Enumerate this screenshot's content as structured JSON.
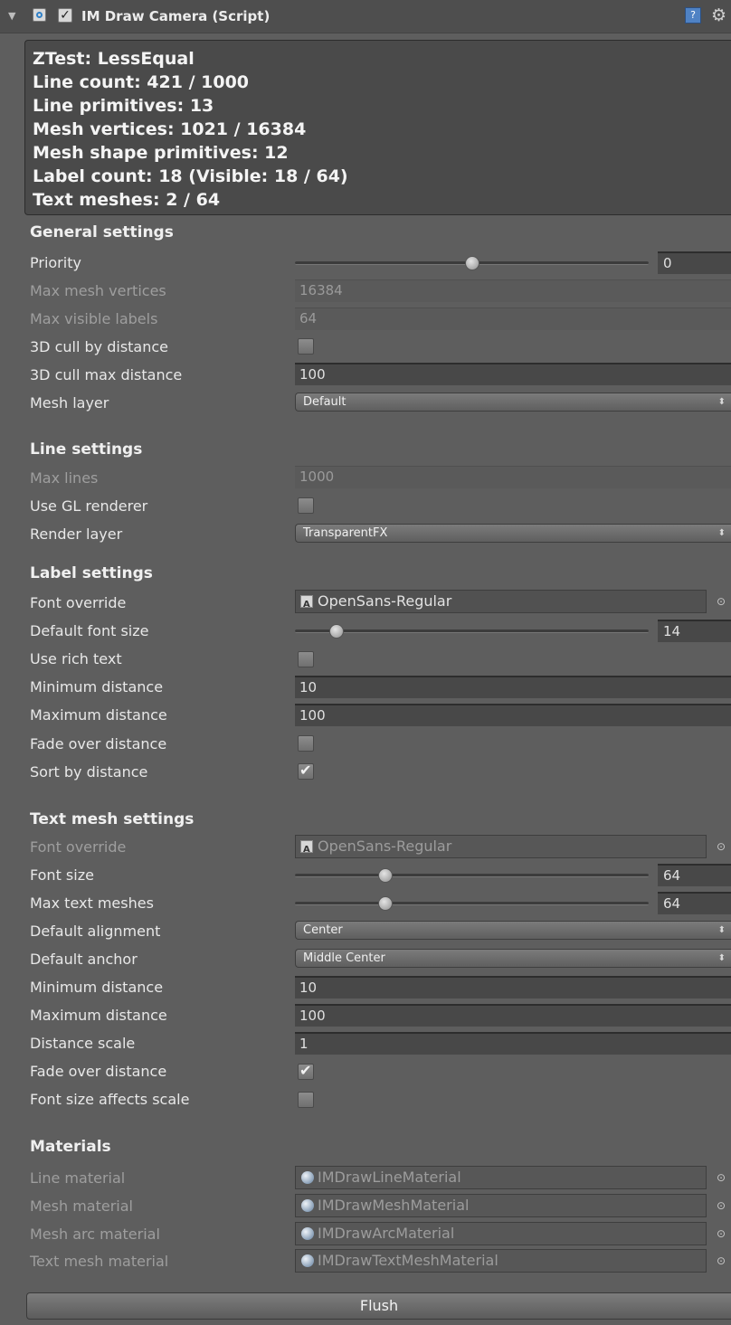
{
  "header": {
    "title": "IM Draw Camera (Script)",
    "enabled": true
  },
  "stats": {
    "lines": [
      "ZTest: LessEqual",
      "Line count: 421 / 1000",
      "Line primitives: 13",
      "Mesh vertices: 1021 / 16384",
      "Mesh shape primitives: 12",
      "Label count: 18 (Visible: 18 / 64)",
      "Text meshes: 2 / 64"
    ]
  },
  "general": {
    "title": "General settings",
    "priority": {
      "label": "Priority",
      "value": "0",
      "slider_fraction": 0.5
    },
    "max_mesh_vertices": {
      "label": "Max mesh vertices",
      "value": "16384"
    },
    "max_visible_labels": {
      "label": "Max visible labels",
      "value": "64"
    },
    "cull_by_distance": {
      "label": "3D cull by distance",
      "checked": false
    },
    "cull_max_distance": {
      "label": "3D cull max distance",
      "value": "100"
    },
    "mesh_layer": {
      "label": "Mesh layer",
      "value": "Default"
    }
  },
  "line": {
    "title": "Line settings",
    "max_lines": {
      "label": "Max lines",
      "value": "1000"
    },
    "use_gl": {
      "label": "Use GL renderer",
      "checked": false
    },
    "render_layer": {
      "label": "Render layer",
      "value": "TransparentFX"
    }
  },
  "label": {
    "title": "Label settings",
    "font_override": {
      "label": "Font override",
      "value": "OpenSans-Regular"
    },
    "default_font_size": {
      "label": "Default font size",
      "value": "14",
      "slider_fraction": 0.11
    },
    "use_rich_text": {
      "label": "Use rich text",
      "checked": false
    },
    "min_distance": {
      "label": "Minimum distance",
      "value": "10"
    },
    "max_distance": {
      "label": "Maximum distance",
      "value": "100"
    },
    "fade": {
      "label": "Fade over distance",
      "checked": false
    },
    "sort": {
      "label": "Sort by distance",
      "checked": true
    }
  },
  "textmesh": {
    "title": "Text mesh settings",
    "font_override": {
      "label": "Font override",
      "value": "OpenSans-Regular"
    },
    "font_size": {
      "label": "Font size",
      "value": "64",
      "slider_fraction": 0.25
    },
    "max_text_meshes": {
      "label": "Max text meshes",
      "value": "64",
      "slider_fraction": 0.25
    },
    "alignment": {
      "label": "Default alignment",
      "value": "Center"
    },
    "anchor": {
      "label": "Default anchor",
      "value": "Middle Center"
    },
    "min_distance": {
      "label": "Minimum distance",
      "value": "10"
    },
    "max_distance": {
      "label": "Maximum distance",
      "value": "100"
    },
    "distance_scale": {
      "label": "Distance scale",
      "value": "1"
    },
    "fade": {
      "label": "Fade over distance",
      "checked": true
    },
    "size_affects_scale": {
      "label": "Font size affects scale",
      "checked": false
    }
  },
  "materials": {
    "title": "Materials",
    "line": {
      "label": "Line material",
      "value": "IMDrawLineMaterial"
    },
    "mesh": {
      "label": "Mesh material",
      "value": "IMDrawMeshMaterial"
    },
    "arc": {
      "label": "Mesh arc material",
      "value": "IMDrawArcMaterial"
    },
    "text": {
      "label": "Text mesh material",
      "value": "IMDrawTextMeshMaterial"
    }
  },
  "actions": {
    "flush_label": "Flush"
  }
}
